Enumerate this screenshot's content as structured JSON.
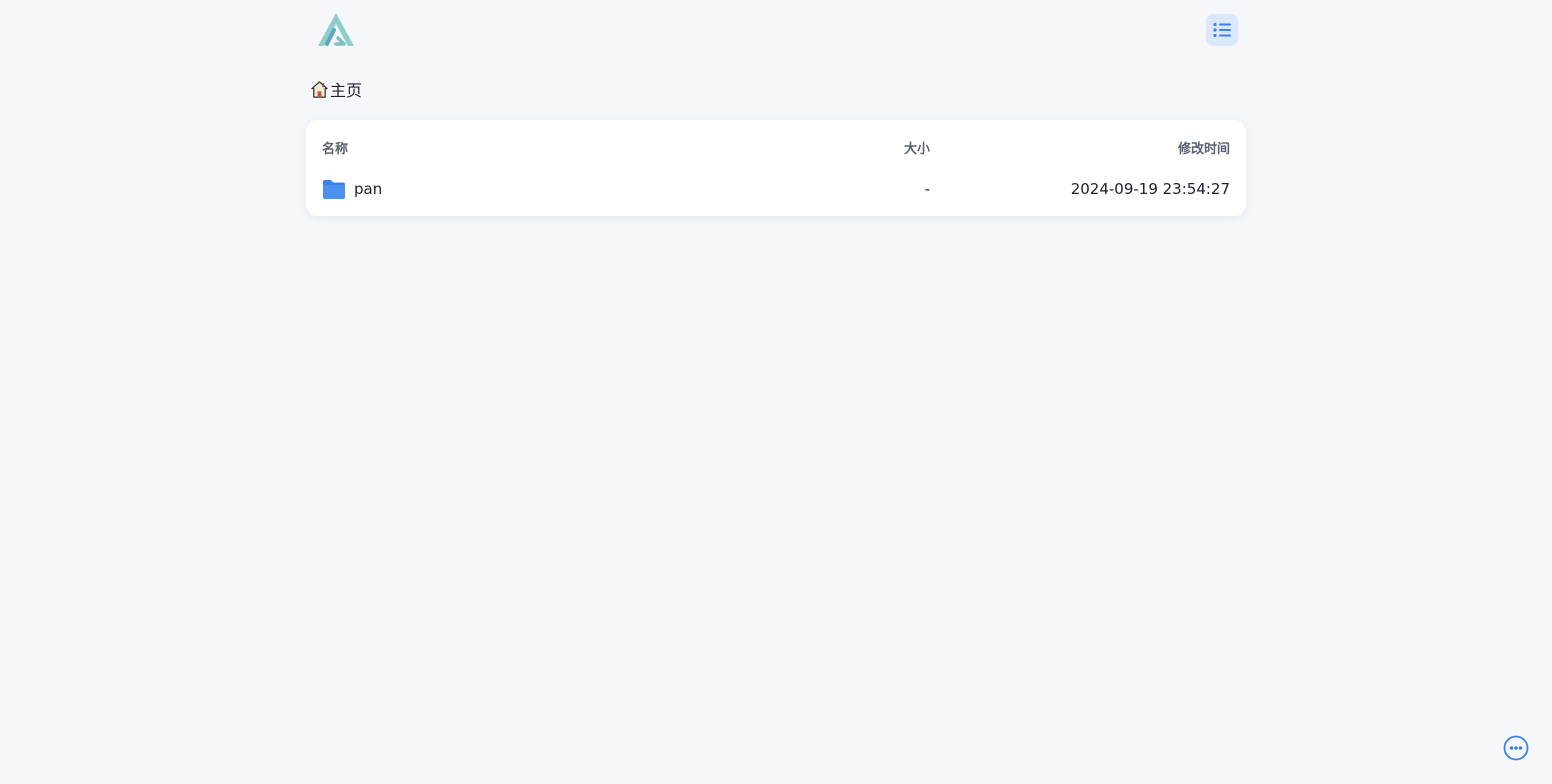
{
  "breadcrumb": {
    "icon": "home-icon",
    "label": "主页"
  },
  "list": {
    "headers": {
      "name": "名称",
      "size": "大小",
      "modified": "修改时间"
    },
    "rows": [
      {
        "icon": "folder-icon",
        "name": "pan",
        "size": "-",
        "modified": "2024-09-19 23:54:27"
      }
    ]
  },
  "colors": {
    "background": "#f5f7fa",
    "accent": "#3b82e6",
    "logo": "#7ec4c4"
  },
  "icons": {
    "logo": "app-logo-icon",
    "menu": "list-menu-icon",
    "more": "more-options-icon"
  }
}
